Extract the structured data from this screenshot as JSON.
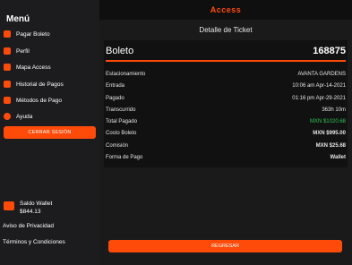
{
  "app": {
    "brand": "Access"
  },
  "sidebar": {
    "title": "Menú",
    "items": [
      {
        "label": "Pagar Boleto",
        "icon": "ticket-icon"
      },
      {
        "label": "Perfil",
        "icon": "user-icon"
      },
      {
        "label": "Mapa Access",
        "icon": "map-icon"
      },
      {
        "label": "Historial de Pagos",
        "icon": "history-icon"
      },
      {
        "label": "Métodos de Pago",
        "icon": "card-icon"
      },
      {
        "label": "Ayuda",
        "icon": "help-icon"
      }
    ],
    "logout_label": "CERRAR SESIÓN",
    "wallet_label": "Saldo Wallet",
    "wallet_amount": "$844.13",
    "privacy_label": "Aviso de Privacidad",
    "terms_label": "Términos y Condiciones"
  },
  "main": {
    "title": "Detalle de Ticket",
    "ticket_label": "Boleto",
    "ticket_number": "168875",
    "rows": [
      {
        "label": "Estacionamiento",
        "value": "AVANTA GARDENS"
      },
      {
        "label": "Entrada",
        "value": "10:06 am Apr-14-2021"
      },
      {
        "label": "Pagado",
        "value": "01:16 pm Apr-29-2021"
      },
      {
        "label": "Transcurrido",
        "value": "363h 10m"
      },
      {
        "label": "Total Pagado",
        "value": "MXN $1020.68"
      },
      {
        "label": "Costo Boleto",
        "value": "MXN $995.00"
      },
      {
        "label": "Comisión",
        "value": "MXN $25.68"
      },
      {
        "label": "Forma de Pago",
        "value": "Wallet"
      }
    ],
    "back_label": "REGRESAR"
  },
  "colors": {
    "accent": "#ff4b0a",
    "success": "#34c759"
  }
}
